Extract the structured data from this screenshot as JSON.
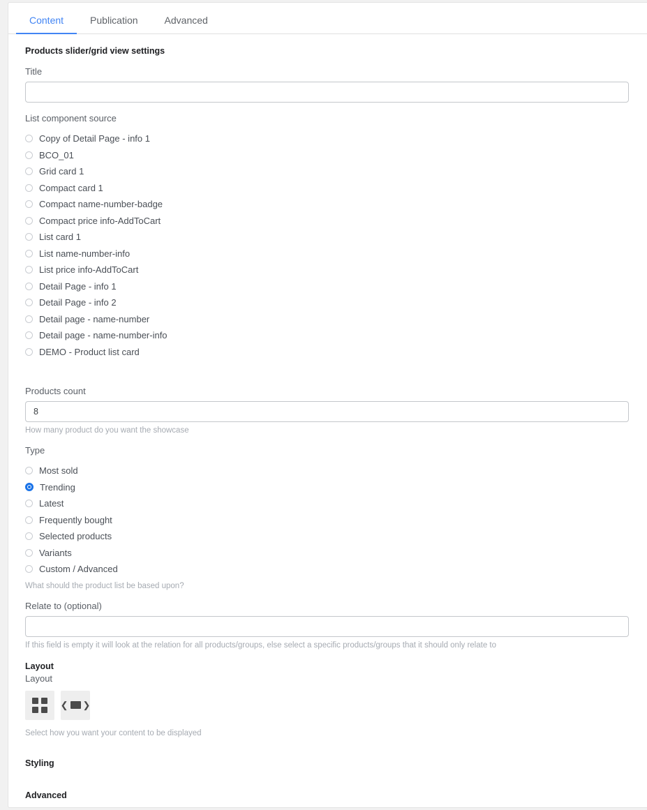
{
  "tabs": [
    {
      "label": "Content",
      "active": true
    },
    {
      "label": "Publication",
      "active": false
    },
    {
      "label": "Advanced",
      "active": false
    }
  ],
  "content": {
    "section_title": "Products slider/grid view settings",
    "title_field": {
      "label": "Title",
      "value": "",
      "placeholder": ""
    },
    "list_source": {
      "label": "List component source",
      "options": [
        "Copy of Detail Page - info 1",
        "BCO_01",
        "Grid card 1",
        "Compact card 1",
        "Compact name-number-badge",
        "Compact price info-AddToCart",
        "List card 1",
        "List name-number-info",
        "List price info-AddToCart",
        "Detail Page - info 1",
        "Detail Page - info 2",
        "Detail page - name-number",
        "Detail page - name-number-info",
        "DEMO - Product list card"
      ],
      "selected": null
    },
    "products_count": {
      "label": "Products count",
      "value": "8",
      "placeholder": "",
      "helper": "How many product do you want the showcase"
    },
    "type": {
      "label": "Type",
      "options": [
        "Most sold",
        "Trending",
        "Latest",
        "Frequently bought",
        "Selected products",
        "Variants",
        "Custom / Advanced"
      ],
      "selected": "Trending",
      "helper": "What should the product list be based upon?"
    },
    "relate_to": {
      "label": "Relate to (optional)",
      "value": "",
      "placeholder": "",
      "helper": "If this field is empty it will look at the relation for all products/groups, else select a specific products/groups that it should only relate to"
    },
    "layout": {
      "section_title": "Layout",
      "field_label": "Layout",
      "helper": "Select how you want your content to be displayed",
      "options": [
        {
          "name": "grid-layout",
          "icon": "grid-icon",
          "selected": true
        },
        {
          "name": "slider-layout",
          "icon": "carousel-icon",
          "selected": false
        }
      ]
    },
    "styling_section": "Styling",
    "advanced_section": "Advanced"
  },
  "colors": {
    "accent": "#4285f4",
    "radio_selected": "#1a73e8",
    "text": "#4a4f56",
    "helper": "#a6abb2"
  }
}
